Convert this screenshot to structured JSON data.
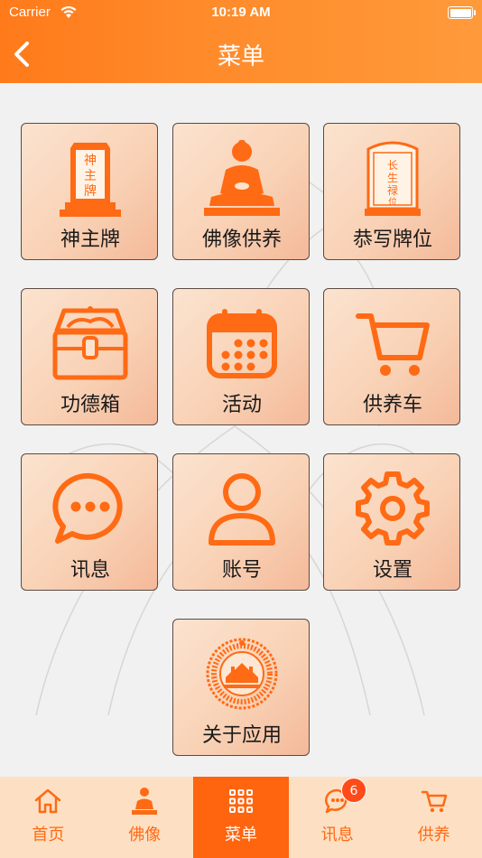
{
  "status_bar": {
    "carrier": "Carrier",
    "time": "10:19 AM"
  },
  "nav": {
    "title": "菜单"
  },
  "menu": {
    "items": [
      {
        "label": "神主牌",
        "icon": "ancestral-tablet-icon"
      },
      {
        "label": "佛像供养",
        "icon": "buddha-statue-icon"
      },
      {
        "label": "恭写牌位",
        "icon": "longevity-tablet-icon"
      },
      {
        "label": "功德箱",
        "icon": "treasure-chest-icon"
      },
      {
        "label": "活动",
        "icon": "calendar-icon"
      },
      {
        "label": "供养车",
        "icon": "shopping-cart-icon"
      },
      {
        "label": "讯息",
        "icon": "chat-bubble-icon"
      },
      {
        "label": "账号",
        "icon": "user-icon"
      },
      {
        "label": "设置",
        "icon": "gear-icon"
      },
      {
        "label": "关于应用",
        "icon": "society-logo-icon"
      }
    ],
    "tablet_text": {
      "shen_zhu_pai": "神主牌",
      "chang_sheng": "长生禄位"
    }
  },
  "tabbar": {
    "tabs": [
      {
        "label": "首页",
        "icon": "home-icon"
      },
      {
        "label": "佛像",
        "icon": "buddha-icon"
      },
      {
        "label": "菜单",
        "icon": "grid-icon",
        "active": true
      },
      {
        "label": "讯息",
        "icon": "chat-icon",
        "badge": "6"
      },
      {
        "label": "供养",
        "icon": "cart-icon"
      }
    ]
  },
  "colors": {
    "accent": "#ff640f",
    "icon": "#ff6a14",
    "tile": "#f9d2b6",
    "tabbar": "#fde0c3"
  }
}
